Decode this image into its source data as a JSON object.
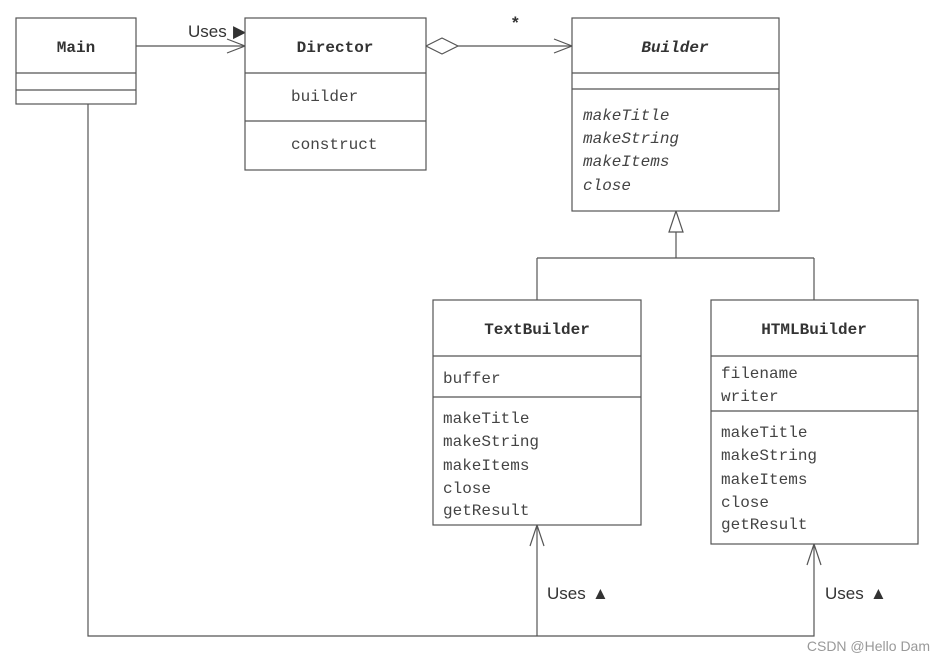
{
  "classes": {
    "main": {
      "name": "Main"
    },
    "director": {
      "name": "Director",
      "fields": [
        "builder"
      ],
      "methods": [
        "construct"
      ]
    },
    "builder": {
      "name": "Builder",
      "abstract": true,
      "methods": [
        "makeTitle",
        "makeString",
        "makeItems",
        "close"
      ]
    },
    "text_builder": {
      "name": "TextBuilder",
      "fields": [
        "buffer"
      ],
      "methods": [
        "makeTitle",
        "makeString",
        "makeItems",
        "close",
        "getResult"
      ]
    },
    "html_builder": {
      "name": "HTMLBuilder",
      "fields": [
        "filename",
        "writer"
      ],
      "methods": [
        "makeTitle",
        "makeString",
        "makeItems",
        "close",
        "getResult"
      ]
    }
  },
  "relations": {
    "main_director": {
      "label": "Uses",
      "arrow_glyph": "▶"
    },
    "director_builder": {
      "multiplicity": "*",
      "type": "aggregation"
    },
    "inheritance": {
      "type": "generalization"
    },
    "main_text_builder": {
      "label": "Uses",
      "arrow_glyph": "▲"
    },
    "main_html_builder": {
      "label": "Uses",
      "arrow_glyph": "▲"
    }
  },
  "watermark": "CSDN @Hello Dam"
}
